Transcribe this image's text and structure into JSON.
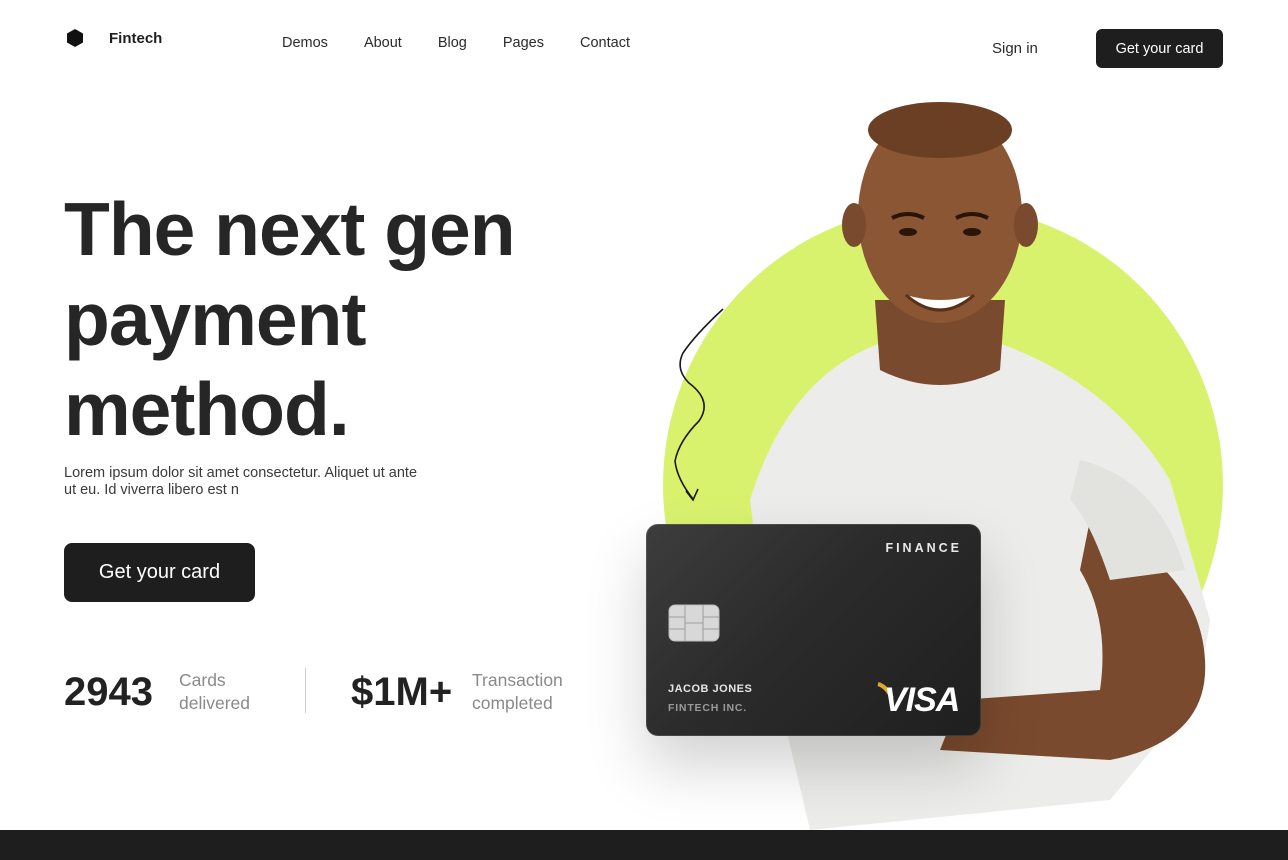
{
  "header": {
    "brand": "Fintech",
    "nav": [
      "Demos",
      "About",
      "Blog",
      "Pages",
      "Contact"
    ],
    "sign_in": "Sign in",
    "cta": "Get your card"
  },
  "hero": {
    "title_lines": [
      "The next gen",
      "payment",
      "method."
    ],
    "subtitle": "Lorem ipsum dolor sit amet consectetur. Aliquet ut ante ut eu. Id viverra libero est n",
    "cta": "Get your card"
  },
  "stats": [
    {
      "value": "2943",
      "label_line1": "Cards",
      "label_line2": "delivered"
    },
    {
      "value": "$1M+",
      "label_line1": "Transaction",
      "label_line2": "completed"
    }
  ],
  "card": {
    "label": "FINANCE",
    "holder": "JACOB JONES",
    "company": "FINTECH INC.",
    "network": "VISA"
  },
  "colors": {
    "accent": "#d9f26e",
    "dark": "#1e1e1e"
  }
}
